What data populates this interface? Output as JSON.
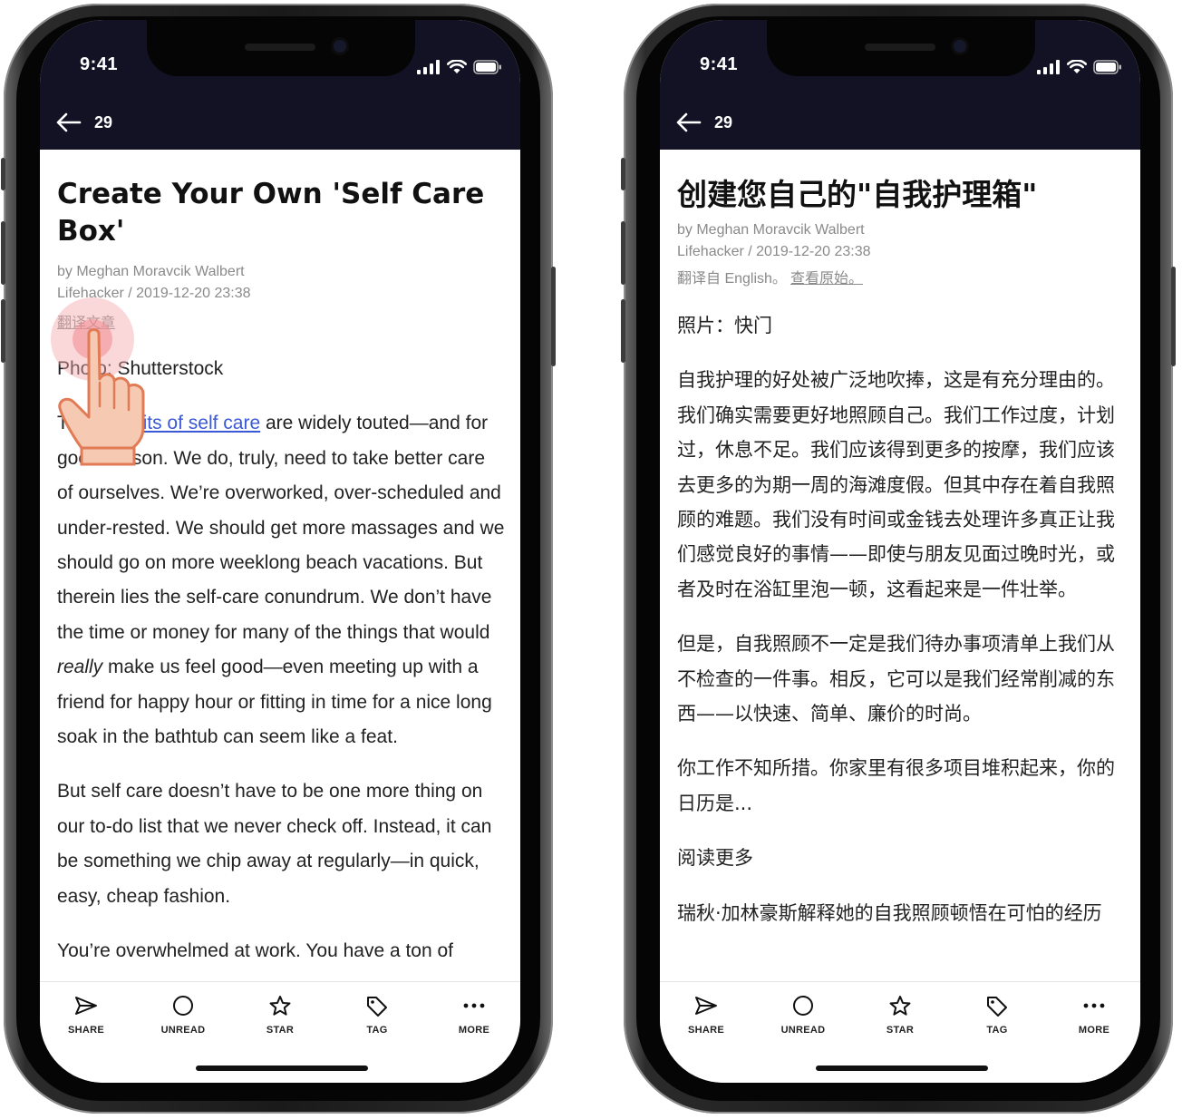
{
  "left": {
    "time": "9:41",
    "nav_count": "29",
    "title": "Create Your Own 'Self Care Box'",
    "byline": "by Meghan Moravcik Walbert",
    "source": "Lifehacker / 2019-12-20 23:38",
    "translate_link": "翻译文章",
    "photo_credit": "Photo: Shutterstock",
    "p1_start": "The ",
    "p1_link": "benefits of self care",
    "p1_mid": " are widely touted—and for good reason. We do, truly, need to take better care of ourselves. We’re overworked, over-scheduled and under-rested. We should get more massages and we should go on more weeklong beach vacations. But therein lies the self-care conundrum. We don’t have the time or money for many of the things that would ",
    "p1_em": "really",
    "p1_end": " make us feel good—even meeting up with a friend for happy hour or fitting in time for a nice long soak in the bathtub can seem like a feat.",
    "p2": "But self care doesn’t have to be one more thing on our to-do list that we never check off. Instead, it can be something we chip away at regularly—in quick, easy, cheap fashion.",
    "p3": "You’re overwhelmed at work. You have a ton of"
  },
  "right": {
    "time": "9:41",
    "nav_count": "29",
    "title": "创建您自己的\"自我护理箱\"",
    "byline": "by Meghan Moravcik Walbert",
    "source": "Lifehacker / 2019-12-20 23:38",
    "translated_from": "翻译自 English。",
    "view_original": "查看原始。",
    "photo_credit": "照片：快门",
    "p1": "自我护理的好处被广泛地吹捧，这是有充分理由的。我们确实需要更好地照顾自己。我们工作过度，计划过，休息不足。我们应该得到更多的按摩，我们应该去更多的为期一周的海滩度假。但其中存在着自我照顾的难题。我们没有时间或金钱去处理许多真正让我们感觉良好的事情——即使与朋友见面过晚时光，或者及时在浴缸里泡一顿，这看起来是一件壮举。",
    "p2": "但是，自我照顾不一定是我们待办事项清单上我们从不检查的一件事。相反，它可以是我们经常削减的东西——以快速、简单、廉价的时尚。",
    "p3": "你工作不知所措。你家里有很多项目堆积起来，你的日历是...",
    "read_more": "阅读更多",
    "p4": "瑞秋·加林豪斯解释她的自我照顾顿悟在可怕的",
    "p4_cut": "经历"
  },
  "toolbar": {
    "share": "SHARE",
    "unread": "UNREAD",
    "star": "STAR",
    "tag": "TAG",
    "more": "MORE"
  },
  "colors": {
    "header_bg": "#121224",
    "link": "#3b59d6",
    "meta": "#8a8a8a",
    "tap_highlight": "#f5a8ac"
  },
  "icons": {
    "back": "arrow-left-icon",
    "signal": "cellular-signal-icon",
    "wifi": "wifi-icon",
    "battery": "battery-icon",
    "share": "paper-plane-icon",
    "unread": "circle-icon",
    "star": "star-icon",
    "tag": "tag-icon",
    "more": "ellipsis-icon",
    "hand": "pointing-hand-icon"
  }
}
